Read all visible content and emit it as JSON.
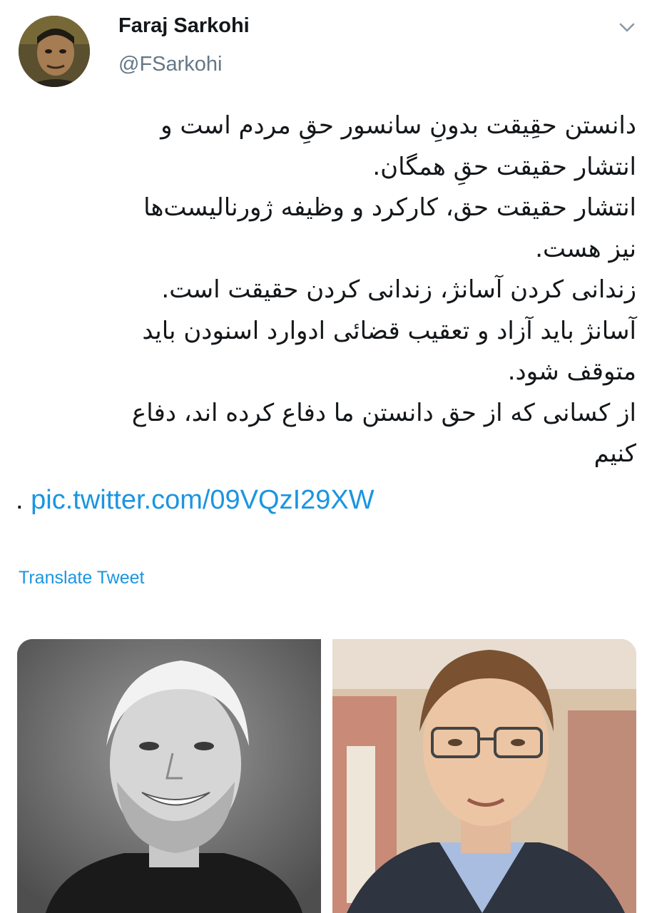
{
  "author": {
    "name": "Faraj Sarkohi",
    "handle": "@FSarkohi"
  },
  "tweet": {
    "lines": [
      "دانستن حقِیقت بدونِ سانسور حقِ مردم است و",
      "انتشار حقیقت حقِ همگان.",
      "انتشار حقیقت حق، کارکرد و وظیفه ژورنالیست‌ها",
      "نیز هست.",
      "زندانی کردن آسانژ، زندانی کردن حقیقت است.",
      "آسانژ باید آزاد و تعقیب قضائی ادوارد اسنودن باید",
      "متوقف شود.",
      "از کسانی که از حق دانستن ما دفاع کرده اند، دفاع",
      "کنیم"
    ],
    "trailing_dot": ".",
    "link": "pic.twitter.com/09VQzI29XW",
    "translate_label": "Translate Tweet"
  },
  "icons": {
    "menu": "chevron-down-icon"
  },
  "colors": {
    "link": "#1b95e0",
    "handle": "#657786",
    "text": "#14171a"
  }
}
